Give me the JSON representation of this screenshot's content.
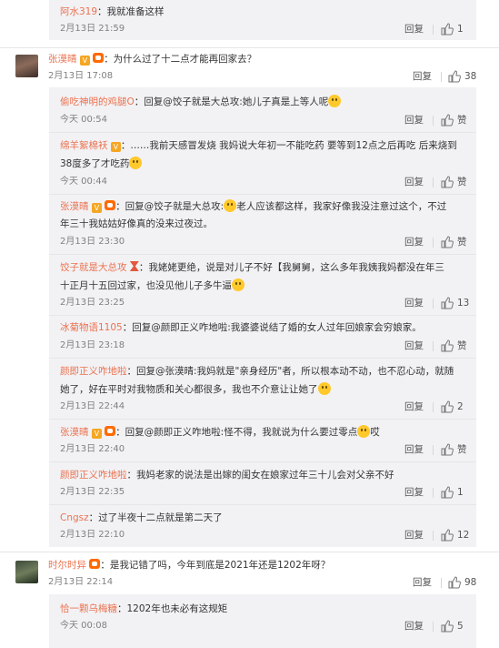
{
  "comments": [
    {
      "id": "c0",
      "author": "阿水319",
      "text": "：我就准备这样",
      "time": "2月13日 21:59",
      "reply": "回复",
      "likes": "1"
    },
    {
      "id": "c1",
      "author": "张漠晴",
      "text": "：为什么过了十二点才能再回家去？",
      "time": "2月13日 17:08",
      "reply": "回复",
      "likes": "38",
      "replies": [
        {
          "author": "偷吃神明的鸡腿O",
          "text": "：回复@饺子就是大总攻:她儿子真是上等人呢",
          "time": "今天 00:54",
          "reply": "回复",
          "likes": "赞"
        },
        {
          "author": "绵羊絮棉袄",
          "text_l1": "：……我前天感冒发烧 我妈说大年初一不能吃药 要等到12点之后再吃 后来烧到",
          "text_l2": "38度多了才吃药",
          "time": "今天 00:44",
          "reply": "回复",
          "likes": "赞"
        },
        {
          "author": "张漠晴",
          "text_l1": "：回复@饺子就是大总攻:",
          "text_l1b": "老人应该都这样，我家好像我没注意过这个，不过",
          "text_l2": "年三十我姑姑好像真的没来过夜过。",
          "time": "2月13日 23:30",
          "reply": "回复",
          "likes": "赞"
        },
        {
          "author": "饺子就是大总攻",
          "text_l1": "：我姥姥更绝，说是对儿子不好【我舅舅，这么多年我姨我妈都没在年三",
          "text_l2": "十正月十五回过家，也没见他儿子多牛逼",
          "time": "2月13日 23:25",
          "reply": "回复",
          "likes": "13"
        },
        {
          "author": "冰菊物语1105",
          "text": "：回复@颜即正义咋地啦:我婆婆说结了婚的女人过年回娘家会穷娘家。",
          "time": "2月13日 23:18",
          "reply": "回复",
          "likes": "赞"
        },
        {
          "author": "颜即正义咋地啦",
          "text_l1": "：回复@张漠晴:我妈就是\"亲身经历\"者，所以根本动不动，也不忍心动，就随",
          "text_l2": "她了，好在平时对我物质和关心都很多，我也不介意让让她了",
          "time": "2月13日 22:44",
          "reply": "回复",
          "likes": "2"
        },
        {
          "author": "张漠晴",
          "text": "：回复@颜即正义咋地啦:怪不得，我就说为什么要过零点",
          "text_end": "哎",
          "time": "2月13日 22:40",
          "reply": "回复",
          "likes": "赞"
        },
        {
          "author": "颜即正义咋地啦",
          "text": "：我妈老家的说法是出嫁的闺女在娘家过年三十儿会对父亲不好",
          "time": "2月13日 22:35",
          "reply": "回复",
          "likes": "1"
        },
        {
          "author": "Cngsz",
          "text": "：过了半夜十二点就是第二天了",
          "time": "2月13日 22:10",
          "reply": "回复",
          "likes": "12"
        }
      ]
    },
    {
      "id": "c2",
      "author": "时尔时异",
      "text": "：是我记错了吗，今年到底是2021年还是1202年呀？",
      "time": "2月13日 22:14",
      "reply": "回复",
      "likes": "98",
      "replies": [
        {
          "author": "恰一颗乌梅糖",
          "text": "：1202年也未必有这规矩",
          "time": "今天 00:08",
          "reply": "回复",
          "likes": "5"
        }
      ]
    }
  ],
  "icons": {
    "like": "thumbs-up-icon",
    "vip": "v-badge",
    "member": "cow-badge",
    "emoji": "smile-emoji"
  },
  "colors": {
    "name": "#eb7350",
    "thread_bg": "#f2f2f5",
    "text": "#333333",
    "muted": "#808080"
  }
}
